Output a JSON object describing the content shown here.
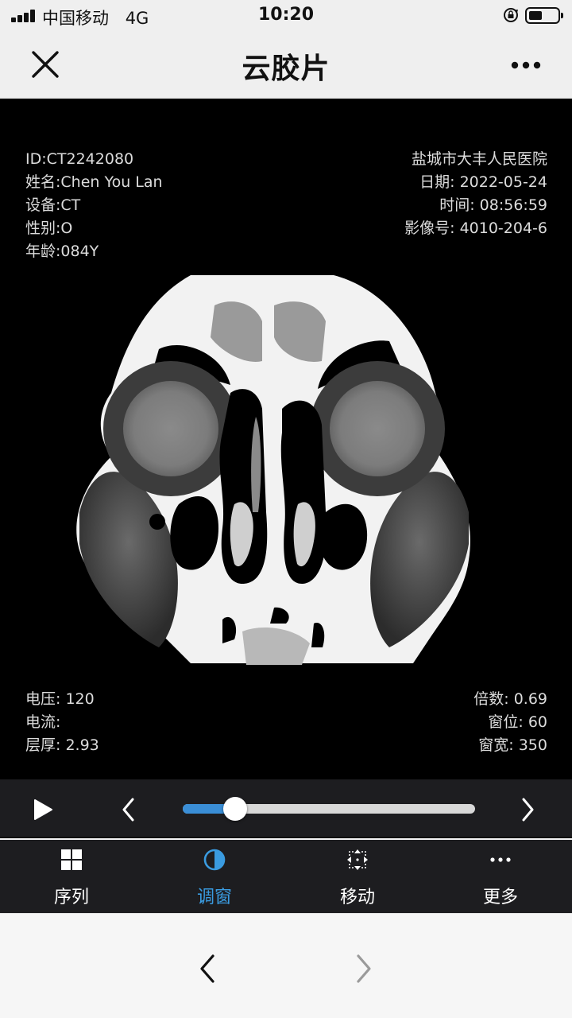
{
  "status_bar": {
    "carrier": "中国移动",
    "network": "4G",
    "time": "10:20",
    "signal_bars": 4,
    "battery_level": 0.45
  },
  "nav": {
    "title": "云胶片",
    "close_icon": "close-icon",
    "more_icon": "more-horizontal-icon"
  },
  "overlay": {
    "top_left": [
      "ID:CT2242080",
      "姓名:Chen You Lan",
      "设备:CT",
      "性别:O",
      "年龄:084Y"
    ],
    "top_right": [
      "盐城市大丰人民医院",
      "日期: 2022-05-24",
      "时间: 08:56:59",
      "影像号: 4010-204-6"
    ],
    "bottom_left": [
      "电压: 120",
      "电流:",
      "层厚: 2.93"
    ],
    "bottom_right": [
      "倍数: 0.69",
      "窗位: 60",
      "窗宽: 350"
    ]
  },
  "playback": {
    "progress": 0.18,
    "accent": "#3a8ed6"
  },
  "tabs": [
    {
      "label": "序列",
      "icon": "grid-icon",
      "active": false
    },
    {
      "label": "调窗",
      "icon": "contrast-icon",
      "active": true
    },
    {
      "label": "移动",
      "icon": "move-icon",
      "active": false
    },
    {
      "label": "更多",
      "icon": "more-icon",
      "active": false
    }
  ],
  "colors": {
    "tab_active": "#3a9be0",
    "tab_inactive": "#ffffff",
    "panel_bg": "#1d1d20"
  }
}
